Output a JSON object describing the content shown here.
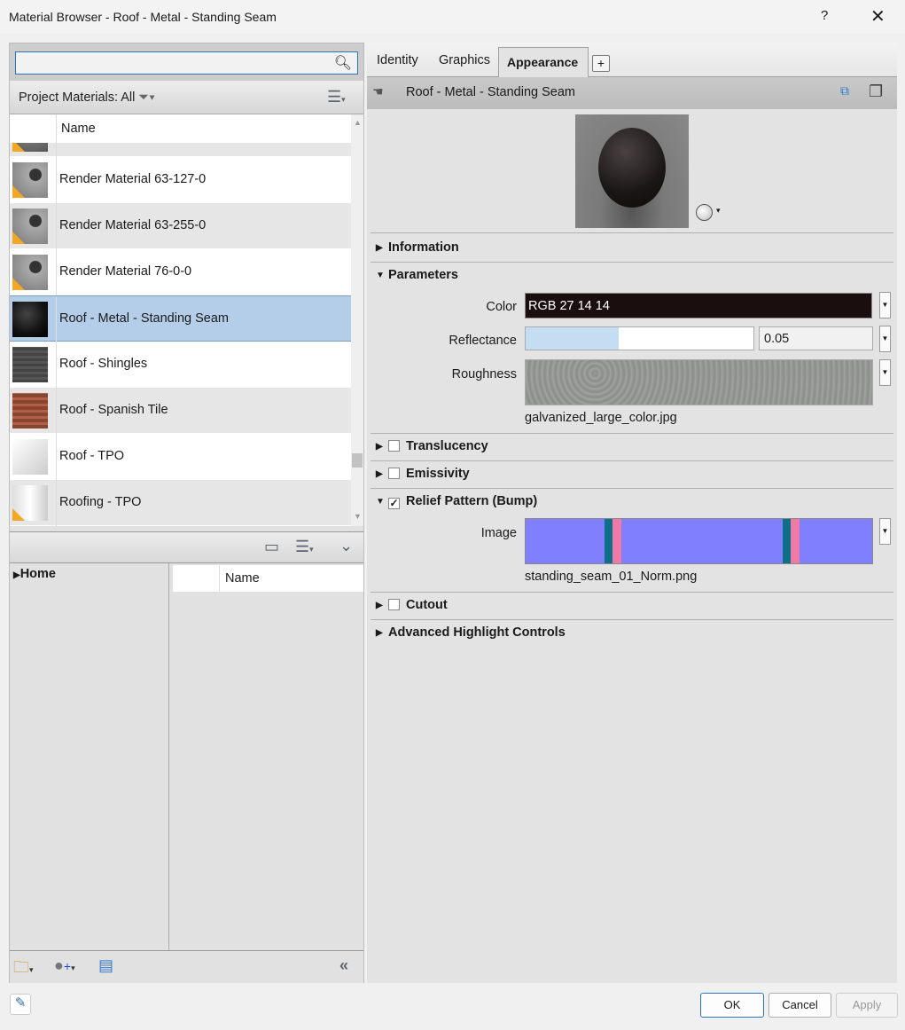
{
  "window": {
    "title": "Material Browser - Roof - Metal - Standing Seam",
    "help": "?",
    "close": "✕"
  },
  "search": {
    "value": "",
    "placeholder": ""
  },
  "filter": {
    "label": "Project Materials: All"
  },
  "list": {
    "column": "Name",
    "items": [
      {
        "name": "Render Material 63-127-0",
        "thumb": "sphere-grey",
        "warn": true
      },
      {
        "name": "Render Material 63-255-0",
        "thumb": "sphere-grey",
        "warn": true
      },
      {
        "name": "Render Material 76-0-0",
        "thumb": "sphere-grey",
        "warn": true
      },
      {
        "name": "Roof - Metal - Standing Seam",
        "thumb": "sphere-black",
        "warn": false,
        "selected": true
      },
      {
        "name": "Roof - Shingles",
        "thumb": "shingles",
        "warn": false
      },
      {
        "name": "Roof - Spanish Tile",
        "thumb": "tile",
        "warn": false
      },
      {
        "name": "Roof - TPO",
        "thumb": "cube",
        "warn": false
      },
      {
        "name": "Roofing - TPO",
        "thumb": "cylinder",
        "warn": true
      }
    ]
  },
  "library": {
    "tree_root": "Home",
    "column": "Name"
  },
  "tabs": [
    "Identity",
    "Graphics",
    "Appearance"
  ],
  "active_tab": "Appearance",
  "asset": {
    "name": "Roof - Metal - Standing Seam"
  },
  "sections": {
    "information": "Information",
    "parameters": "Parameters",
    "translucency": "Translucency",
    "emissivity": "Emissivity",
    "relief": "Relief Pattern (Bump)",
    "cutout": "Cutout",
    "advanced": "Advanced Highlight Controls"
  },
  "params": {
    "color_label": "Color",
    "color_value": "RGB 27 14 14",
    "color_hex": "#1b0e0e",
    "reflectance_label": "Reflectance",
    "reflectance_value": "0.05",
    "reflectance_fill_percent": 41,
    "roughness_label": "Roughness",
    "roughness_file": "galvanized_large_color.jpg",
    "image_label": "Image",
    "image_file": "standing_seam_01_Norm.png"
  },
  "checks": {
    "translucency": false,
    "emissivity": false,
    "relief": true,
    "cutout": false
  },
  "buttons": {
    "ok": "OK",
    "cancel": "Cancel",
    "apply": "Apply"
  }
}
